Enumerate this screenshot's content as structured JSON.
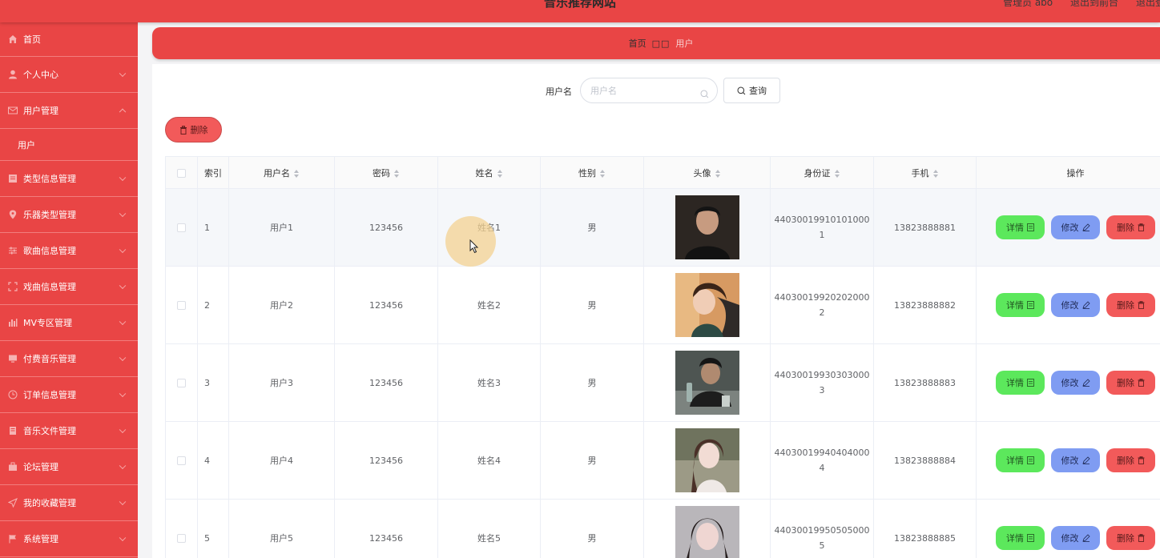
{
  "header": {
    "site_title": "音乐推荐网站",
    "admin_text": "管理员 abo",
    "frontend_link": "退出到前台",
    "logout_link": "退出登录"
  },
  "sidebar": {
    "items": [
      {
        "label": "首页",
        "icon": "home-icon"
      },
      {
        "label": "个人中心",
        "icon": "user-icon"
      },
      {
        "label": "用户管理",
        "icon": "message-icon",
        "expanded": true
      },
      {
        "label": "用户",
        "sub": true
      },
      {
        "label": "类型信息管理",
        "icon": "document-icon"
      },
      {
        "label": "乐器类型管理",
        "icon": "location-icon"
      },
      {
        "label": "歌曲信息管理",
        "icon": "sliders-icon"
      },
      {
        "label": "戏曲信息管理",
        "icon": "fullscreen-icon"
      },
      {
        "label": "MV专区管理",
        "icon": "chart-icon"
      },
      {
        "label": "付费音乐管理",
        "icon": "monitor-icon"
      },
      {
        "label": "订单信息管理",
        "icon": "clock-icon"
      },
      {
        "label": "音乐文件管理",
        "icon": "notebook-icon"
      },
      {
        "label": "论坛管理",
        "icon": "suitcase-icon"
      },
      {
        "label": "我的收藏管理",
        "icon": "send-icon"
      },
      {
        "label": "系统管理",
        "icon": "flag-icon"
      }
    ]
  },
  "breadcrumb": {
    "home": "首页",
    "separator": "□□",
    "current": "用户"
  },
  "search": {
    "label": "用户名",
    "placeholder": "用户名",
    "query_button": "查询"
  },
  "toolbar": {
    "delete_button": "删除"
  },
  "table": {
    "headers": [
      "索引",
      "用户名",
      "密码",
      "姓名",
      "性别",
      "头像",
      "身份证",
      "手机",
      "操作"
    ],
    "rows": [
      {
        "index": "1",
        "username": "用户1",
        "password": "123456",
        "name": "姓名1",
        "gender": "男",
        "id_line1": "44030019910101000",
        "id_line2": "1",
        "phone": "13823888881"
      },
      {
        "index": "2",
        "username": "用户2",
        "password": "123456",
        "name": "姓名2",
        "gender": "男",
        "id_line1": "44030019920202000",
        "id_line2": "2",
        "phone": "13823888882"
      },
      {
        "index": "3",
        "username": "用户3",
        "password": "123456",
        "name": "姓名3",
        "gender": "男",
        "id_line1": "44030019930303000",
        "id_line2": "3",
        "phone": "13823888883"
      },
      {
        "index": "4",
        "username": "用户4",
        "password": "123456",
        "name": "姓名4",
        "gender": "男",
        "id_line1": "44030019940404000",
        "id_line2": "4",
        "phone": "13823888884"
      },
      {
        "index": "5",
        "username": "用户5",
        "password": "123456",
        "name": "姓名5",
        "gender": "男",
        "id_line1": "44030019950505000",
        "id_line2": "5",
        "phone": "13823888885"
      }
    ],
    "actions": {
      "detail": "详情",
      "edit": "修改",
      "delete": "删除"
    }
  },
  "colors": {
    "primary": "#e94545",
    "detail_button": "#5ce85c",
    "edit_button": "#7f9cf2",
    "delete_button": "#f25a5a"
  }
}
